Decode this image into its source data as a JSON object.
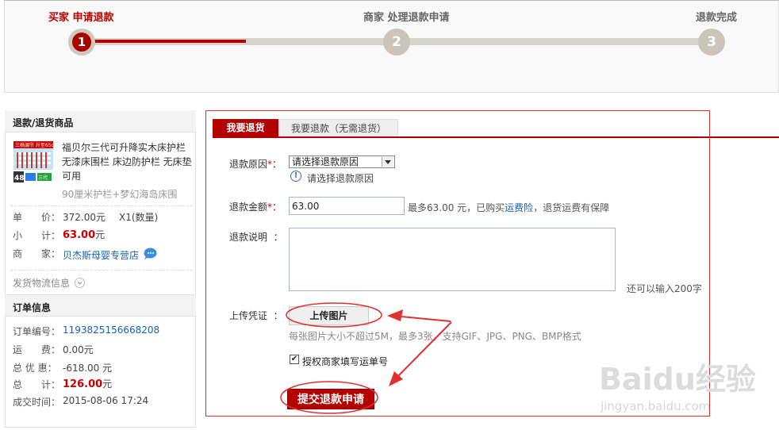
{
  "progress": {
    "steps": [
      {
        "number": "1",
        "label": "买家 申请退款"
      },
      {
        "number": "2",
        "label": "商家 处理退款申请"
      },
      {
        "number": "3",
        "label": "退款完成"
      }
    ],
    "current_step": 1
  },
  "left": {
    "goods_title": "退款/退货商品",
    "product_name": "福贝尔三代可升降实木床护栏 无漆床围栏 床边防护栏 无床垫可用",
    "product_spec": "90厘米护栏+梦幻海岛床围",
    "unit_price_label": "单　　价：",
    "unit_price": "372.00元",
    "quantity": "X1(数量)",
    "subtotal_label": "小　　计：",
    "subtotal_amount": "63.00",
    "subtotal_unit": "元",
    "merchant_label": "商　　家：",
    "merchant_name": "贝杰斯母婴专营店",
    "logistics_label": "发货物流信息",
    "order_title": "订单信息",
    "order_no_label": "订单编号：",
    "order_no": "1193825156668208",
    "shipping_label": "运　　费：",
    "shipping": "0.00元",
    "discount_label": "总 优 惠：",
    "discount": "-618.00 元",
    "total_label": "总　　计：",
    "total_amount": "126.00",
    "total_unit": "元",
    "time_label": "成交时间：",
    "time": "2015-08-06 17:24",
    "thumb_text": {
      "top": "三档调节 升至65cm",
      "num": "48",
      "tag": "三代"
    }
  },
  "form": {
    "tab_active": "我要退货",
    "tab_inactive": "我要退款（无需退货）",
    "reason_label": "退款原因",
    "reason_value": "请选择退款原因",
    "reason_hint": "请选择退款原因",
    "amount_label": "退款金额",
    "amount_value": "63.00",
    "amount_note_prefix": "最多63.00 元，已购买",
    "amount_note_link": "运费险",
    "amount_note_suffix": "，退货运费有保障",
    "desc_label": "退款说明",
    "colon": "：",
    "char_note": "还可以输入200字",
    "proof_label": "上传凭证",
    "upload_button": "上传图片",
    "upload_note": "每张图片大小不超过5M，最多3张，支持GIF、JPG、PNG、BMP格式",
    "auth_label": "授权商家填写运单号",
    "submit_button": "提交退款申请",
    "required_mark": "*"
  },
  "watermark": {
    "brand": "Baidu经验",
    "url": "jingyan.baidu.com"
  },
  "colors": {
    "accent": "#b30000",
    "link": "#1862b2",
    "annotation": "#e03030"
  }
}
